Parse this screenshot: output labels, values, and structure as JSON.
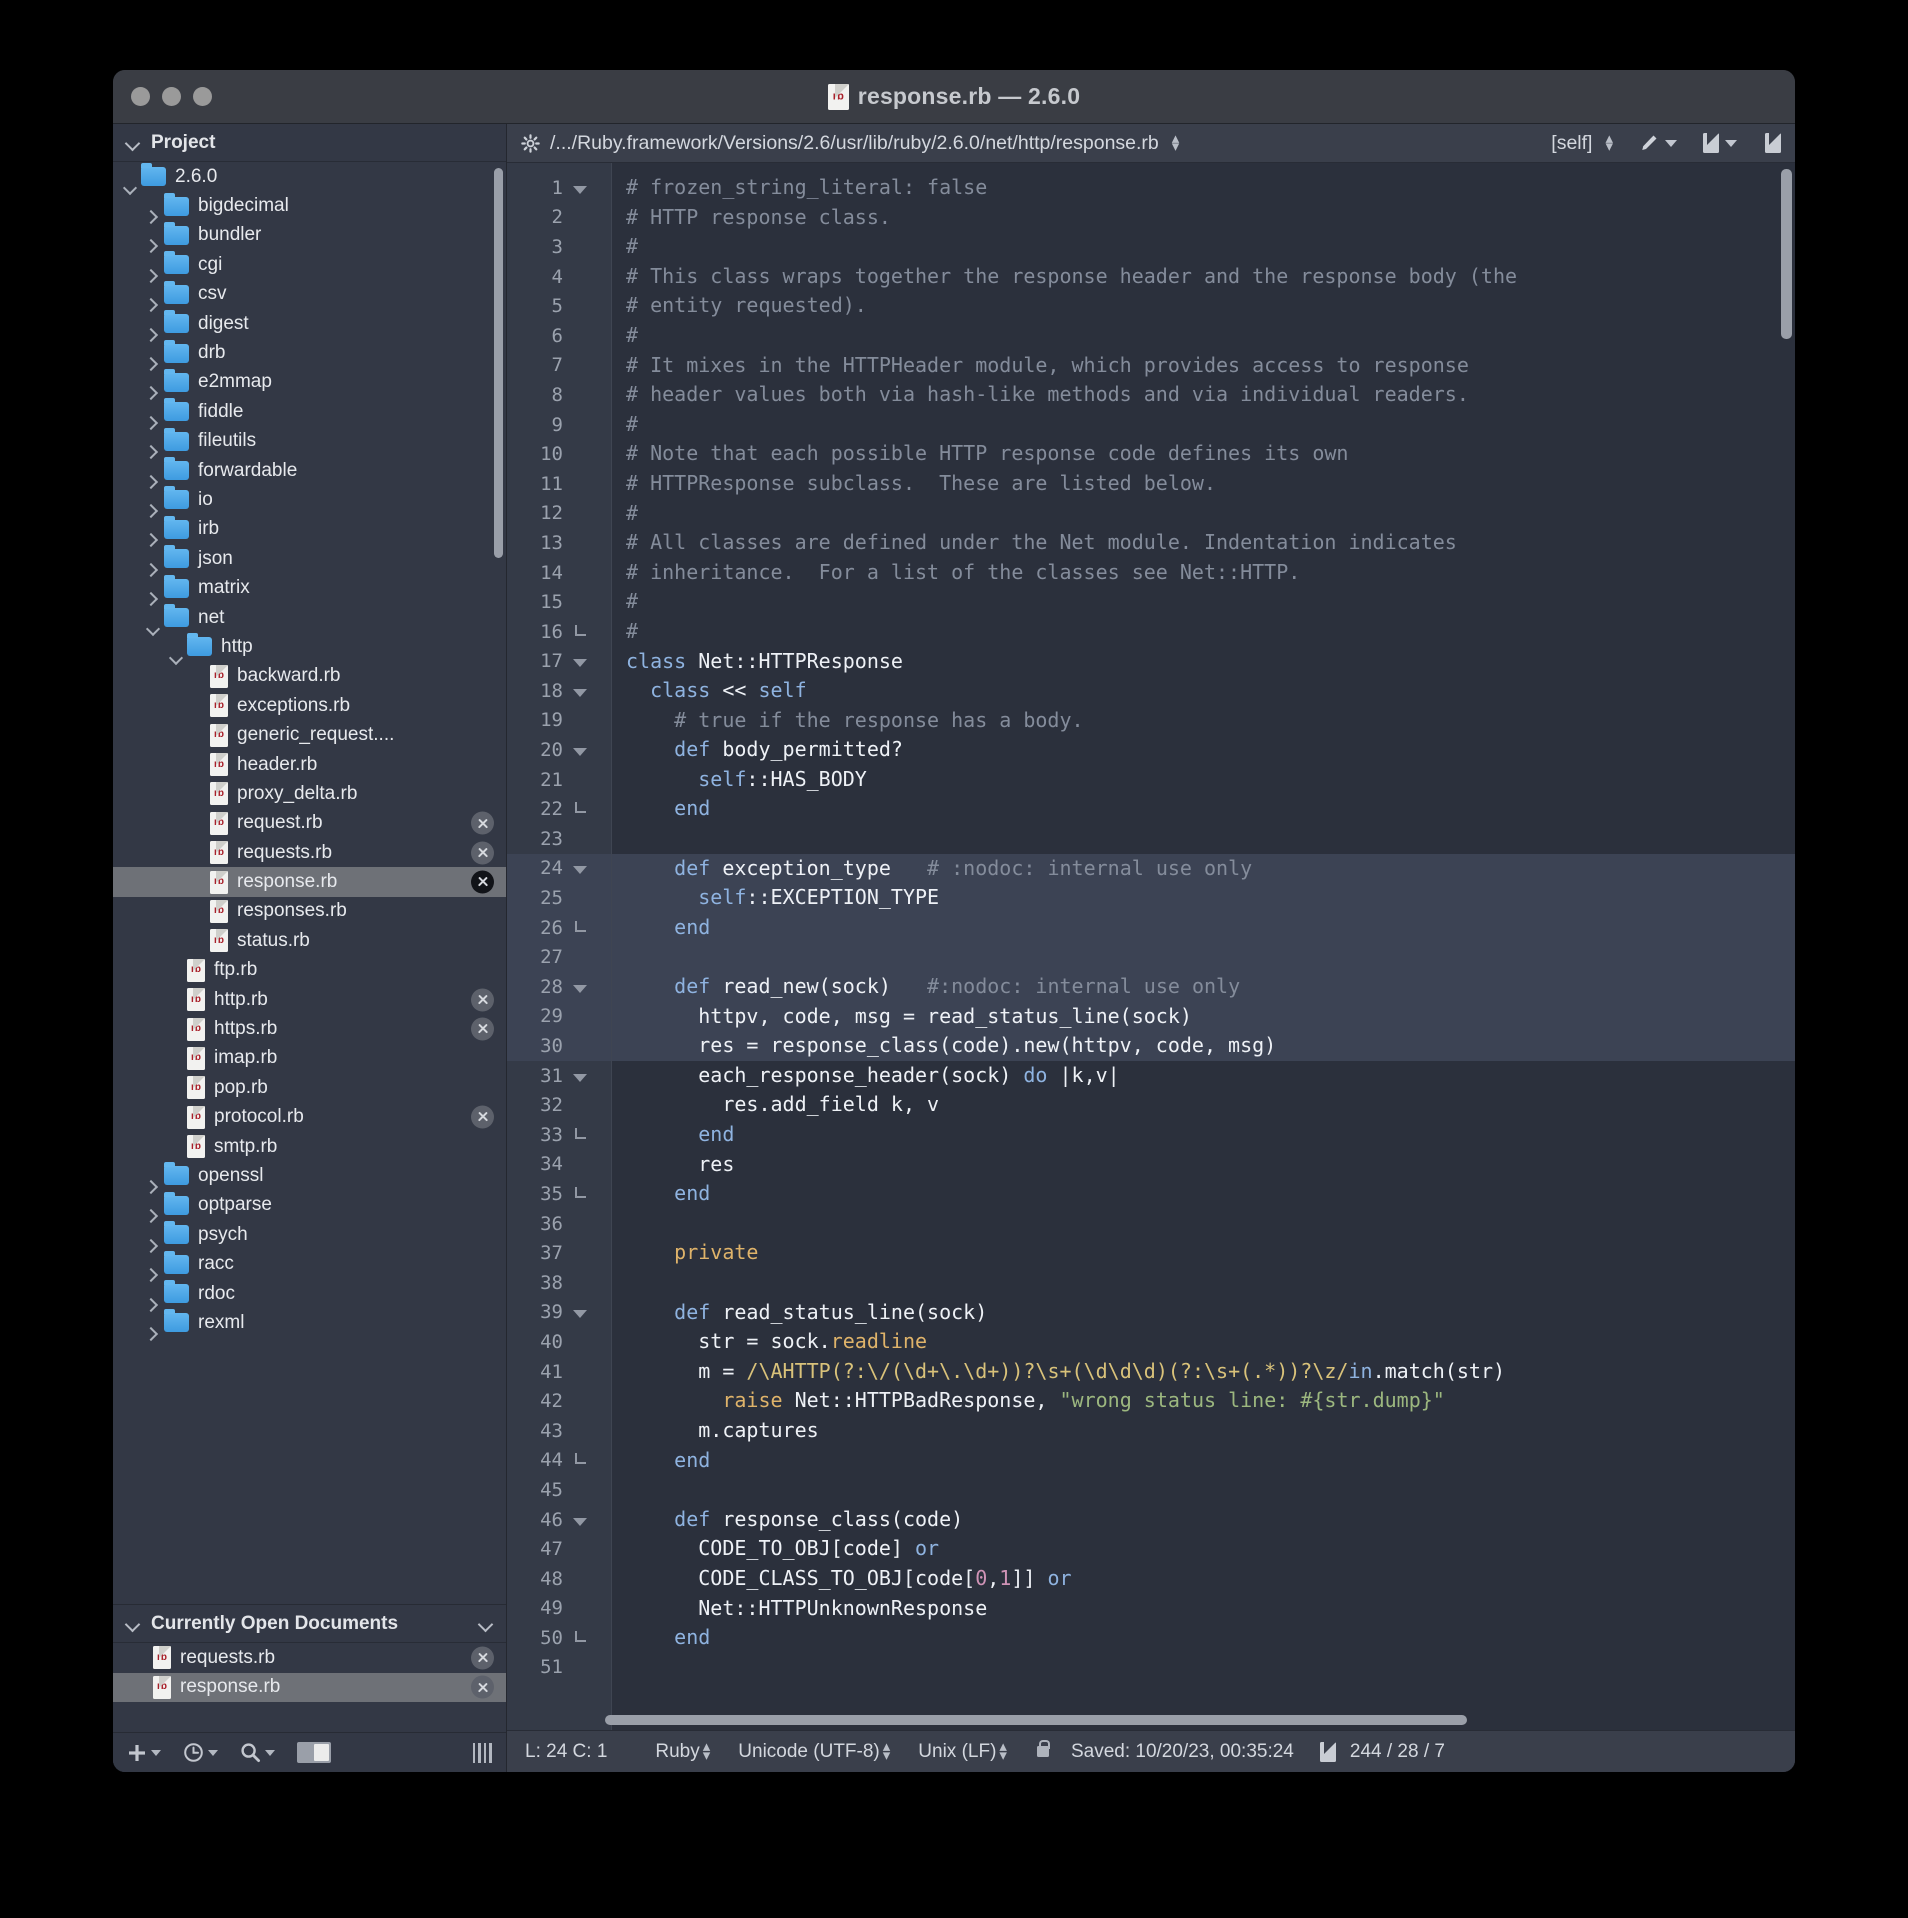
{
  "window": {
    "title": "response.rb — 2.6.0",
    "file_icon": "rb-file-icon",
    "traffic_lights": [
      "close-button",
      "minimize-button",
      "zoom-button"
    ]
  },
  "sidebar": {
    "project_header": {
      "label": "Project",
      "disclosure": "chevron-down-icon"
    },
    "tree": [
      {
        "label": "2.6.0",
        "type": "folder",
        "indent": 0,
        "state": "expanded"
      },
      {
        "label": "bigdecimal",
        "type": "folder",
        "indent": 1,
        "state": "collapsed"
      },
      {
        "label": "bundler",
        "type": "folder",
        "indent": 1,
        "state": "collapsed"
      },
      {
        "label": "cgi",
        "type": "folder",
        "indent": 1,
        "state": "collapsed"
      },
      {
        "label": "csv",
        "type": "folder",
        "indent": 1,
        "state": "collapsed"
      },
      {
        "label": "digest",
        "type": "folder",
        "indent": 1,
        "state": "collapsed"
      },
      {
        "label": "drb",
        "type": "folder",
        "indent": 1,
        "state": "collapsed"
      },
      {
        "label": "e2mmap",
        "type": "folder",
        "indent": 1,
        "state": "collapsed"
      },
      {
        "label": "fiddle",
        "type": "folder",
        "indent": 1,
        "state": "collapsed"
      },
      {
        "label": "fileutils",
        "type": "folder",
        "indent": 1,
        "state": "collapsed"
      },
      {
        "label": "forwardable",
        "type": "folder",
        "indent": 1,
        "state": "collapsed"
      },
      {
        "label": "io",
        "type": "folder",
        "indent": 1,
        "state": "collapsed"
      },
      {
        "label": "irb",
        "type": "folder",
        "indent": 1,
        "state": "collapsed"
      },
      {
        "label": "json",
        "type": "folder",
        "indent": 1,
        "state": "collapsed"
      },
      {
        "label": "matrix",
        "type": "folder",
        "indent": 1,
        "state": "collapsed"
      },
      {
        "label": "net",
        "type": "folder",
        "indent": 1,
        "state": "expanded"
      },
      {
        "label": "http",
        "type": "folder",
        "indent": 2,
        "state": "expanded"
      },
      {
        "label": "backward.rb",
        "type": "file",
        "indent": 3,
        "close": false
      },
      {
        "label": "exceptions.rb",
        "type": "file",
        "indent": 3,
        "close": false
      },
      {
        "label": "generic_request....",
        "type": "file",
        "indent": 3,
        "close": false
      },
      {
        "label": "header.rb",
        "type": "file",
        "indent": 3,
        "close": false
      },
      {
        "label": "proxy_delta.rb",
        "type": "file",
        "indent": 3,
        "close": false
      },
      {
        "label": "request.rb",
        "type": "file",
        "indent": 3,
        "close": true
      },
      {
        "label": "requests.rb",
        "type": "file",
        "indent": 3,
        "close": true
      },
      {
        "label": "response.rb",
        "type": "file",
        "indent": 3,
        "close": true,
        "selected": true
      },
      {
        "label": "responses.rb",
        "type": "file",
        "indent": 3,
        "close": false
      },
      {
        "label": "status.rb",
        "type": "file",
        "indent": 3,
        "close": false
      },
      {
        "label": "ftp.rb",
        "type": "file",
        "indent": 2,
        "close": false
      },
      {
        "label": "http.rb",
        "type": "file",
        "indent": 2,
        "close": true
      },
      {
        "label": "https.rb",
        "type": "file",
        "indent": 2,
        "close": true
      },
      {
        "label": "imap.rb",
        "type": "file",
        "indent": 2,
        "close": false
      },
      {
        "label": "pop.rb",
        "type": "file",
        "indent": 2,
        "close": false
      },
      {
        "label": "protocol.rb",
        "type": "file",
        "indent": 2,
        "close": true
      },
      {
        "label": "smtp.rb",
        "type": "file",
        "indent": 2,
        "close": false
      },
      {
        "label": "openssl",
        "type": "folder",
        "indent": 1,
        "state": "collapsed"
      },
      {
        "label": "optparse",
        "type": "folder",
        "indent": 1,
        "state": "collapsed"
      },
      {
        "label": "psych",
        "type": "folder",
        "indent": 1,
        "state": "collapsed"
      },
      {
        "label": "racc",
        "type": "folder",
        "indent": 1,
        "state": "collapsed"
      },
      {
        "label": "rdoc",
        "type": "folder",
        "indent": 1,
        "state": "collapsed"
      },
      {
        "label": "rexml",
        "type": "folder",
        "indent": 1,
        "state": "collapsed"
      }
    ],
    "open_documents": {
      "header": "Currently Open Documents",
      "items": [
        {
          "label": "requests.rb",
          "selected": false,
          "close": true
        },
        {
          "label": "response.rb",
          "selected": true,
          "close": true
        }
      ]
    },
    "toolbar": {
      "add_label": "+",
      "icons": [
        "plus-icon",
        "clock-icon",
        "search-icon",
        "panel-toggle-icon",
        "resize-grip-icon"
      ]
    }
  },
  "editor": {
    "toolbar": {
      "gear": "gear-icon",
      "path": "/.../Ruby.framework/Versions/2.6/usr/lib/ruby/2.6.0/net/http/response.rb",
      "scope": "[self]",
      "icons": [
        "pencil-icon",
        "chevron-down-icon",
        "split-view-icon",
        "chevron-down-icon",
        "new-document-icon"
      ]
    },
    "lines": [
      {
        "n": 1,
        "fold": "open",
        "tokens": [
          [
            "cm",
            "# frozen_string_literal: false"
          ]
        ]
      },
      {
        "n": 2,
        "fold": "",
        "tokens": [
          [
            "cm",
            "# HTTP response class."
          ]
        ]
      },
      {
        "n": 3,
        "fold": "",
        "tokens": [
          [
            "cm",
            "#"
          ]
        ]
      },
      {
        "n": 4,
        "fold": "",
        "tokens": [
          [
            "cm",
            "# This class wraps together the response header and the response body (the"
          ]
        ]
      },
      {
        "n": 5,
        "fold": "",
        "tokens": [
          [
            "cm",
            "# entity requested)."
          ]
        ]
      },
      {
        "n": 6,
        "fold": "",
        "tokens": [
          [
            "cm",
            "#"
          ]
        ]
      },
      {
        "n": 7,
        "fold": "",
        "tokens": [
          [
            "cm",
            "# It mixes in the HTTPHeader module, which provides access to response"
          ]
        ]
      },
      {
        "n": 8,
        "fold": "",
        "tokens": [
          [
            "cm",
            "# header values both via hash-like methods and via individual readers."
          ]
        ]
      },
      {
        "n": 9,
        "fold": "",
        "tokens": [
          [
            "cm",
            "#"
          ]
        ]
      },
      {
        "n": 10,
        "fold": "",
        "tokens": [
          [
            "cm",
            "# Note that each possible HTTP response code defines its own"
          ]
        ]
      },
      {
        "n": 11,
        "fold": "",
        "tokens": [
          [
            "cm",
            "# HTTPResponse subclass.  These are listed below."
          ]
        ]
      },
      {
        "n": 12,
        "fold": "",
        "tokens": [
          [
            "cm",
            "#"
          ]
        ]
      },
      {
        "n": 13,
        "fold": "",
        "tokens": [
          [
            "cm",
            "# All classes are defined under the Net module. Indentation indicates"
          ]
        ]
      },
      {
        "n": 14,
        "fold": "",
        "tokens": [
          [
            "cm",
            "# inheritance.  For a list of the classes see Net::HTTP."
          ]
        ]
      },
      {
        "n": 15,
        "fold": "",
        "tokens": [
          [
            "cm",
            "#"
          ]
        ]
      },
      {
        "n": 16,
        "fold": "end",
        "tokens": [
          [
            "cm",
            "#"
          ]
        ]
      },
      {
        "n": 17,
        "fold": "open",
        "tokens": [
          [
            "kw",
            "class "
          ],
          [
            "id",
            "Net::HTTPResponse"
          ]
        ]
      },
      {
        "n": 18,
        "fold": "open",
        "tokens": [
          [
            "id",
            "  "
          ],
          [
            "kw",
            "class "
          ],
          [
            "id",
            "<< "
          ],
          [
            "kw",
            "self"
          ]
        ]
      },
      {
        "n": 19,
        "fold": "",
        "tokens": [
          [
            "cm",
            "    # true if the response has a body."
          ]
        ]
      },
      {
        "n": 20,
        "fold": "open",
        "tokens": [
          [
            "id",
            "    "
          ],
          [
            "kw",
            "def "
          ],
          [
            "id",
            "body_permitted?"
          ]
        ]
      },
      {
        "n": 21,
        "fold": "",
        "tokens": [
          [
            "id",
            "      "
          ],
          [
            "kw",
            "self"
          ],
          [
            "id",
            "::HAS_BODY"
          ]
        ]
      },
      {
        "n": 22,
        "fold": "end",
        "tokens": [
          [
            "id",
            "    "
          ],
          [
            "kw",
            "end"
          ]
        ]
      },
      {
        "n": 23,
        "fold": "",
        "tokens": [
          [
            "id",
            ""
          ]
        ]
      },
      {
        "n": 24,
        "fold": "open",
        "hl": true,
        "tokens": [
          [
            "id",
            "    "
          ],
          [
            "kw",
            "def "
          ],
          [
            "id",
            "exception_type"
          ],
          [
            "cm",
            "   # :nodoc: internal use only"
          ]
        ]
      },
      {
        "n": 25,
        "fold": "",
        "hl": true,
        "tokens": [
          [
            "id",
            "      "
          ],
          [
            "kw",
            "self"
          ],
          [
            "id",
            "::EXCEPTION_TYPE"
          ]
        ]
      },
      {
        "n": 26,
        "fold": "end",
        "hl": true,
        "tokens": [
          [
            "id",
            "    "
          ],
          [
            "kw",
            "end"
          ]
        ]
      },
      {
        "n": 27,
        "fold": "",
        "hl": true,
        "tokens": [
          [
            "id",
            ""
          ]
        ]
      },
      {
        "n": 28,
        "fold": "open",
        "hl": true,
        "tokens": [
          [
            "id",
            "    "
          ],
          [
            "kw",
            "def "
          ],
          [
            "id",
            "read_new(sock)"
          ],
          [
            "cm",
            "   #:nodoc: internal use only"
          ]
        ]
      },
      {
        "n": 29,
        "fold": "",
        "hl": true,
        "tokens": [
          [
            "id",
            "      httpv, code, msg = read_status_line(sock)"
          ]
        ]
      },
      {
        "n": 30,
        "fold": "",
        "hl": true,
        "tokens": [
          [
            "id",
            "      res = response_class(code).new(httpv, code, msg)"
          ]
        ]
      },
      {
        "n": 31,
        "fold": "open",
        "tokens": [
          [
            "id",
            "      each_response_header(sock) "
          ],
          [
            "kw",
            "do"
          ],
          [
            "id",
            " |k,v|"
          ]
        ]
      },
      {
        "n": 32,
        "fold": "",
        "tokens": [
          [
            "id",
            "        res.add_field k, v"
          ]
        ]
      },
      {
        "n": 33,
        "fold": "end",
        "tokens": [
          [
            "id",
            "      "
          ],
          [
            "kw",
            "end"
          ]
        ]
      },
      {
        "n": 34,
        "fold": "",
        "tokens": [
          [
            "id",
            "      res"
          ]
        ]
      },
      {
        "n": 35,
        "fold": "end",
        "tokens": [
          [
            "id",
            "    "
          ],
          [
            "kw",
            "end"
          ]
        ]
      },
      {
        "n": 36,
        "fold": "",
        "tokens": [
          [
            "id",
            ""
          ]
        ]
      },
      {
        "n": 37,
        "fold": "",
        "tokens": [
          [
            "priv",
            "    private"
          ]
        ]
      },
      {
        "n": 38,
        "fold": "",
        "tokens": [
          [
            "id",
            ""
          ]
        ]
      },
      {
        "n": 39,
        "fold": "open",
        "tokens": [
          [
            "id",
            "    "
          ],
          [
            "kw",
            "def "
          ],
          [
            "id",
            "read_status_line(sock)"
          ]
        ]
      },
      {
        "n": 40,
        "fold": "",
        "tokens": [
          [
            "id",
            "      str = sock."
          ],
          [
            "priv",
            "readline"
          ]
        ]
      },
      {
        "n": 41,
        "fold": "",
        "tokens": [
          [
            "id",
            "      m = "
          ],
          [
            "rex",
            "/\\AHTTP(?:\\/(\\d+\\.\\d+))?\\s+(\\d\\d\\d)(?:\\s+(.*))?\\z/"
          ],
          [
            "kw",
            "in"
          ],
          [
            "id",
            ".match(str)"
          ]
        ]
      },
      {
        "n": 42,
        "fold": "",
        "tokens": [
          [
            "id",
            "        "
          ],
          [
            "priv",
            "raise"
          ],
          [
            "id",
            " Net::HTTPBadResponse, "
          ],
          [
            "str",
            "\"wrong status line: #{str.dump}\""
          ]
        ]
      },
      {
        "n": 43,
        "fold": "",
        "tokens": [
          [
            "id",
            "      m.captures"
          ]
        ]
      },
      {
        "n": 44,
        "fold": "end",
        "tokens": [
          [
            "id",
            "    "
          ],
          [
            "kw",
            "end"
          ]
        ]
      },
      {
        "n": 45,
        "fold": "",
        "tokens": [
          [
            "id",
            ""
          ]
        ]
      },
      {
        "n": 46,
        "fold": "open",
        "tokens": [
          [
            "id",
            "    "
          ],
          [
            "kw",
            "def "
          ],
          [
            "id",
            "response_class(code)"
          ]
        ]
      },
      {
        "n": 47,
        "fold": "",
        "tokens": [
          [
            "id",
            "      CODE_TO_OBJ[code] "
          ],
          [
            "kw",
            "or"
          ]
        ]
      },
      {
        "n": 48,
        "fold": "",
        "tokens": [
          [
            "id",
            "      CODE_CLASS_TO_OBJ[code["
          ],
          [
            "num",
            "0"
          ],
          [
            "id",
            ","
          ],
          [
            "num",
            "1"
          ],
          [
            "id",
            "]] "
          ],
          [
            "kw",
            "or"
          ]
        ]
      },
      {
        "n": 49,
        "fold": "",
        "tokens": [
          [
            "id",
            "      Net::HTTPUnknownResponse"
          ]
        ]
      },
      {
        "n": 50,
        "fold": "end",
        "tokens": [
          [
            "id",
            "    "
          ],
          [
            "kw",
            "end"
          ]
        ]
      },
      {
        "n": 51,
        "fold": "",
        "tokens": [
          [
            "id",
            ""
          ]
        ]
      }
    ]
  },
  "statusbar": {
    "cursor": "L: 24 C: 1",
    "language": "Ruby",
    "encoding": "Unicode (UTF-8)",
    "line_endings": "Unix (LF)",
    "lock_icon": "lock-icon",
    "saved": "Saved: 10/20/23, 00:35:24",
    "doc_icon": "document-icon",
    "counts": "244 / 28 / 7"
  },
  "colors": {
    "window_bg": "#2f3440",
    "sidebar_bg": "#333845",
    "editor_bg": "#2b303c",
    "selection": "#3c4354",
    "row_selected": "#6e7177",
    "comment": "#848c9b",
    "keyword": "#8fb3e0",
    "string": "#9cb77f",
    "regex": "#d9c27a",
    "number": "#cf93b6",
    "accent_orange": "#dfb36a"
  }
}
